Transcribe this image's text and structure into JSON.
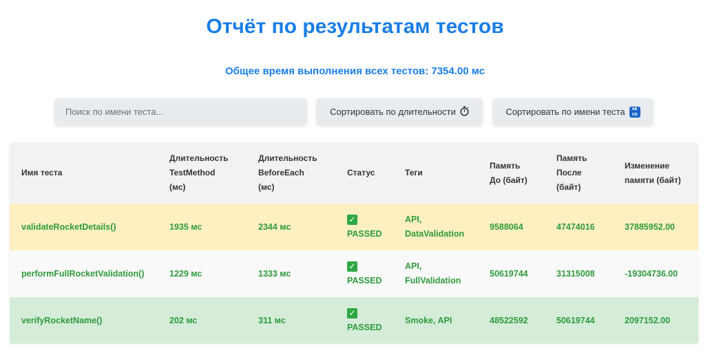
{
  "header": {
    "title": "Отчёт по результатам тестов",
    "total_time": "Общее время выполнения всех тестов: 7354.00 мс"
  },
  "controls": {
    "search_placeholder": "Поиск по имени теста...",
    "sort_duration_label": "Сортировать по длительности",
    "sort_duration_icon": "stopwatch-icon",
    "sort_name_label": "Сортировать по имени теста",
    "sort_name_icon": "abcd-icon",
    "abcd_icon_text_top": "AB",
    "abcd_icon_text_bottom": "CD"
  },
  "table": {
    "headers": {
      "name": "Имя теста",
      "duration_test_1": "Длительность",
      "duration_test_2": "TestMethod",
      "duration_test_3": "(мс)",
      "duration_before_1": "Длительность",
      "duration_before_2": "BeforeEach",
      "duration_before_3": "(мс)",
      "status": "Статус",
      "tags": "Теги",
      "mem_before_1": "Память",
      "mem_before_2": "До (байт)",
      "mem_after_1": "Память",
      "mem_after_2": "После",
      "mem_after_3": "(байт)",
      "mem_change_1": "Изменение",
      "mem_change_2": "памяти (байт)"
    },
    "rows": [
      {
        "name": "validateRocketDetails()",
        "duration_test": "1935 мс",
        "duration_before": "2344 мс",
        "status": "PASSED",
        "tags_1": "API,",
        "tags_2": "DataValidation",
        "mem_before": "9588064",
        "mem_after": "47474016",
        "mem_change": "37885952.00"
      },
      {
        "name": "performFullRocketValidation()",
        "duration_test": "1229 мс",
        "duration_before": "1333 мс",
        "status": "PASSED",
        "tags_1": "API,",
        "tags_2": "FullValidation",
        "mem_before": "50619744",
        "mem_after": "31315008",
        "mem_change": "-19304736.00"
      },
      {
        "name": "verifyRocketName()",
        "duration_test": "202 мс",
        "duration_before": "311 мс",
        "status": "PASSED",
        "tags_1": "Smoke, API",
        "tags_2": "",
        "mem_before": "48522592",
        "mem_after": "50619744",
        "mem_change": "2097152.00"
      }
    ],
    "check_icon": "✓"
  },
  "colors": {
    "accent": "#1a7ee6",
    "passed_text": "#2e9b3c",
    "row_highlight_yellow": "#fff0c2",
    "row_highlight_green": "#d5ecd9"
  }
}
